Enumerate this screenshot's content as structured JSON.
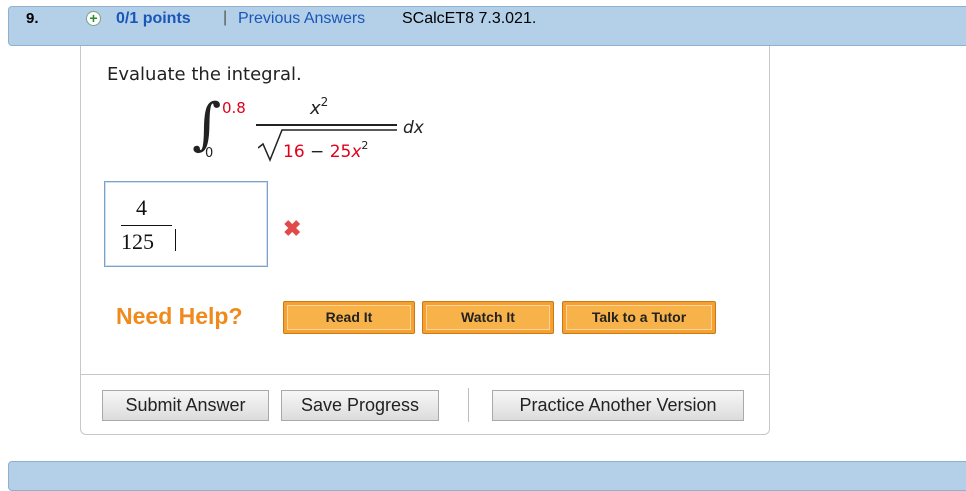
{
  "header": {
    "number": "9.",
    "points": "0/1 points",
    "separator": "|",
    "previous_answers": "Previous Answers",
    "reference": "SCalcET8 7.3.021."
  },
  "question": {
    "prompt": "Evaluate the integral.",
    "upper_limit": "0.8",
    "lower_limit": "0",
    "numerator": "x",
    "numerator_exp": "2",
    "denominator_constant": "16",
    "denominator_op": " − ",
    "denominator_coef": "25",
    "denominator_var": "x",
    "denominator_exp": "2",
    "differential": "dx"
  },
  "answer": {
    "numerator": "4",
    "denominator": "125",
    "status": "incorrect"
  },
  "help": {
    "label": "Need Help?",
    "read_it": "Read It",
    "watch_it": "Watch It",
    "tutor": "Talk to a Tutor"
  },
  "footer": {
    "submit": "Submit Answer",
    "save": "Save Progress",
    "practice": "Practice Another Version"
  },
  "colors": {
    "header_bg": "#b3d0e8",
    "link": "#1a56b8",
    "highlight_red": "#e0001b",
    "help_orange": "#f08a1c"
  }
}
